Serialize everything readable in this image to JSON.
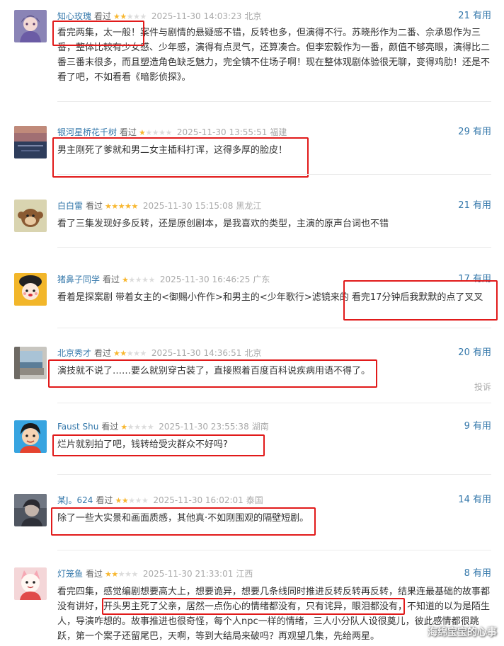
{
  "watched_label": "看过",
  "useful_suffix": "有用",
  "report_label": "投诉",
  "colors": {
    "star_on": "#f8b72f",
    "star_off": "#dcdcdc",
    "user": "#3377aa",
    "highlight": "#e11a1a"
  },
  "comments": [
    {
      "user": "知心玫瑰",
      "stars": 2,
      "time": "2025-11-30 14:03:23",
      "location": "北京",
      "useful_count": "21",
      "text": "看完两集，太一般！案件与剧情的悬疑感不错，反转也多，但演得不行。苏晓彤作为二番、佘承恩作为三番，整体比较有少女感、少年感，演得有点灵气，还算凑合。但李宏毅作为一番，颜值不够亮眼，演得比二番三番末很多，而且塑造角色缺乏魅力，完全镇不住场子啊！现在整体观剧体验很无聊，变得鸡肋！还是不看了吧，不如看看《暗影侦探》。",
      "avatar": "avatar-girl-illustration"
    },
    {
      "user": "银河星桥花千树",
      "stars": 1,
      "time": "2025-11-30 13:55:51",
      "location": "福建",
      "useful_count": "29",
      "text": "男主刚死了爹就和男二女主插科打诨，这得多厚的脸皮！",
      "avatar": "avatar-sunset-sea"
    },
    {
      "user": "白白雷",
      "stars": 5,
      "time": "2025-11-30 15:15:08",
      "location": "黑龙江",
      "useful_count": "21",
      "text": "看了三集发现好多反转，还是原创剧本，是我喜欢的类型，主演的原声台词也不错",
      "avatar": "avatar-monkey-cartoon"
    },
    {
      "user": "猪鼻子同学",
      "stars": 1,
      "time": "2025-11-30 16:46:25",
      "location": "广东",
      "useful_count": "17",
      "text": "看着是探案剧 带着女主的<御赐小仵作>和男主的<少年歌行>滤镜来的 看完17分钟后我默默的点了叉叉",
      "avatar": "avatar-cartoon-face"
    },
    {
      "user": "北京秀才",
      "stars": 2,
      "time": "2025-11-30 14:36:51",
      "location": "北京",
      "useful_count": "20",
      "text": "演技就不说了……要么就别穿古装了，直接照着百度百科说疾病用语不得了。",
      "avatar": "avatar-window-seaview",
      "show_report": true
    },
    {
      "user": "Faust Shu",
      "stars": 1,
      "time": "2025-11-30 23:55:38",
      "location": "湖南",
      "useful_count": "9",
      "text": "烂片就别拍了吧，钱转给受灾群众不好吗?",
      "avatar": "avatar-cartoon-boy"
    },
    {
      "user": "某J。624",
      "stars": 2,
      "time": "2025-11-30 16:02:01",
      "location": "泰国",
      "useful_count": "14",
      "text": "除了一些大实景和画面质感，其他真·不如刚围观的隔壁短剧。",
      "avatar": "avatar-dark-portrait"
    },
    {
      "user": "灯笼鱼",
      "stars": 2,
      "time": "2025-11-30 21:33:01",
      "location": "江西",
      "useful_count": "8",
      "text": "看完四集，感觉编剧想要高大上，想要诡异，想要几条线同时推进反转反转再反转，结果连最基础的故事都没有讲好，开头男主死了父亲，居然一点伤心的情绪都没有，只有诧异，眼泪都没有，不知道的以为是陌生人，导演咋想的。故事推进也很奇怪，每个人npc一样的情绪，三人小分队人设很奠儿，彼此感情都很跳跃，第一个案子还留尾巴，天啊，等到大结局来破吗？再观望几集，先给两星。",
      "avatar": "avatar-lucky-cat"
    }
  ],
  "watermark": "海绵宝宝的心事"
}
